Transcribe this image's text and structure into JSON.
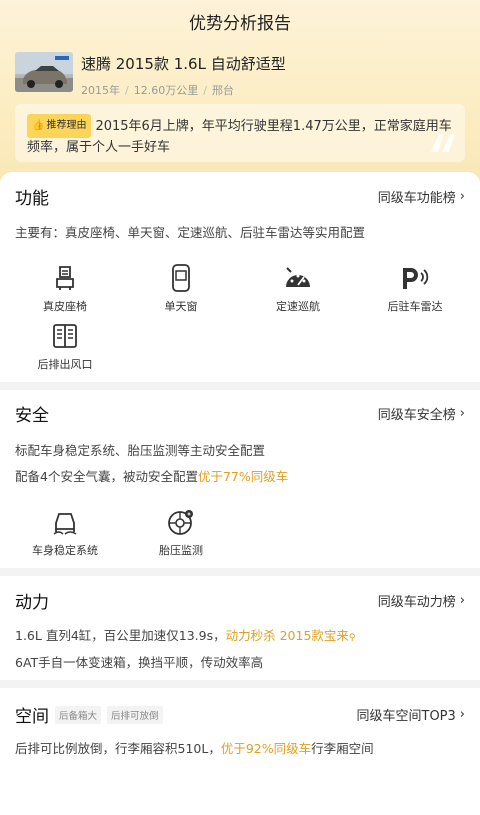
{
  "page": {
    "title": "优势分析报告"
  },
  "car": {
    "name": "速腾 2015款 1.6L 自动舒适型",
    "year": "2015年",
    "mileage": "12.60万公里",
    "city": "邢台"
  },
  "reason": {
    "badge": "推荐理由",
    "text": "2015年6月上牌，年平均行驶里程1.47万公里，正常家庭用车频率，属于个人一手好车"
  },
  "function": {
    "title": "功能",
    "link": "同级车功能榜",
    "summary": "主要有：真皮座椅、单天窗、定速巡航、后驻车雷达等实用配置",
    "items": [
      {
        "label": "真皮座椅",
        "icon": "seat-icon"
      },
      {
        "label": "单天窗",
        "icon": "sunroof-icon"
      },
      {
        "label": "定速巡航",
        "icon": "cruise-icon"
      },
      {
        "label": "后驻车雷达",
        "icon": "parking-radar-icon"
      },
      {
        "label": "后排出风口",
        "icon": "air-vent-icon"
      }
    ]
  },
  "safety": {
    "title": "安全",
    "link": "同级车安全榜",
    "line1": "标配车身稳定系统、胎压监测等主动安全配置",
    "line2_pre": "配备4个安全气囊，被动安全配置",
    "line2_hl": "优于77%同级车",
    "items": [
      {
        "label": "车身稳定系统",
        "icon": "stability-icon"
      },
      {
        "label": "胎压监测",
        "icon": "tire-pressure-icon"
      }
    ]
  },
  "power": {
    "title": "动力",
    "link": "同级车动力榜",
    "line1_pre": "1.6L 直列4缸，百公里加速仅13.9s，",
    "line1_hl": "动力秒杀 2015款宝来",
    "line2": "6AT手自一体变速箱，换挡平顺，传动效率高"
  },
  "space": {
    "title": "空间",
    "tags": [
      "后备箱大",
      "后排可放倒"
    ],
    "link": "同级车空间TOP3",
    "line_pre": "后排可比例放倒，行李厢容积510L，",
    "line_hl": "优于92%同级车",
    "line_post": "行李厢空间"
  },
  "colors": {
    "accent": "#e0a01f",
    "badge": "#fbd45a"
  }
}
